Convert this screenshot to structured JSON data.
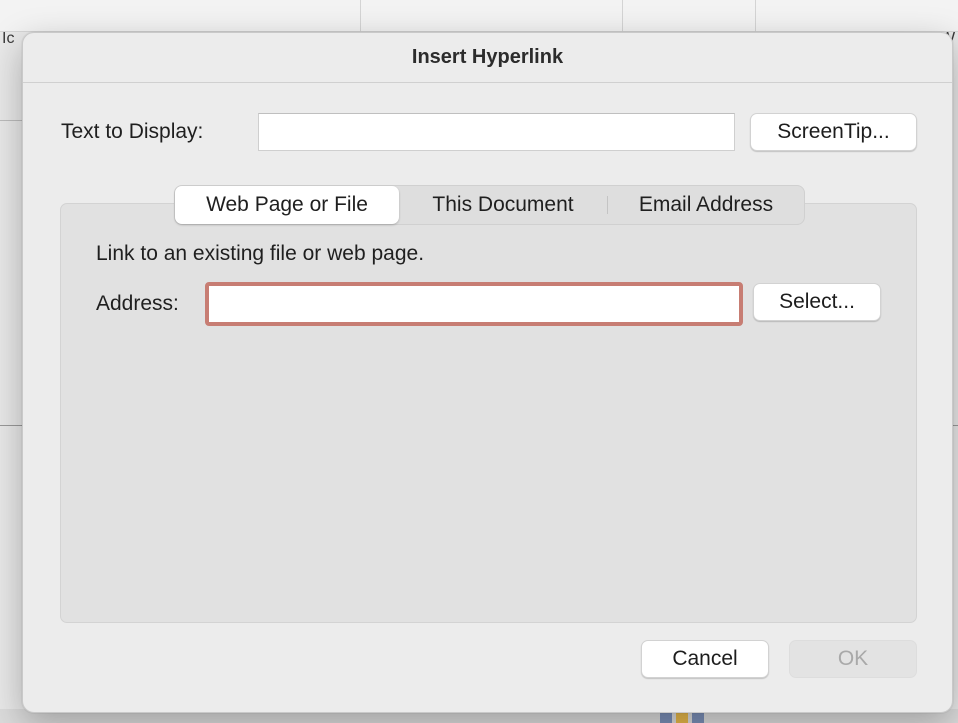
{
  "background": {
    "fragments": [
      "Ic",
      "W"
    ]
  },
  "dialog": {
    "title": "Insert Hyperlink",
    "text_to_display": {
      "label": "Text to Display:",
      "value": ""
    },
    "screentip_label": "ScreenTip...",
    "tabs": [
      {
        "label": "Web Page or File",
        "active": true
      },
      {
        "label": "This Document",
        "active": false
      },
      {
        "label": "Email Address",
        "active": false
      }
    ],
    "panel": {
      "description": "Link to an existing file or web page.",
      "address_label": "Address:",
      "address_value": "",
      "select_label": "Select..."
    },
    "cancel_label": "Cancel",
    "ok_label": "OK"
  },
  "colors": {
    "focus_ring": "#c77d73",
    "dialog_bg": "#ececec",
    "panel_bg": "#e1e1e1"
  }
}
